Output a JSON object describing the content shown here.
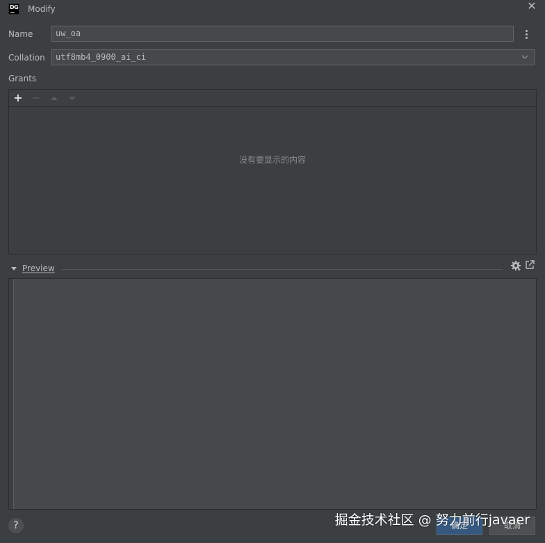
{
  "window": {
    "title": "Modify"
  },
  "form": {
    "name_label": "Name",
    "name_value": "uw_oa",
    "collation_label": "Collation",
    "collation_value": "utf8mb4_0900_ai_ci"
  },
  "grants": {
    "label": "Grants",
    "empty_text": "没有要显示的内容",
    "toolbar": {
      "add": "+",
      "remove": "−"
    }
  },
  "preview": {
    "label": "Preview"
  },
  "footer": {
    "help": "?",
    "ok_label": "确定",
    "cancel_label": "取消"
  },
  "watermark": "掘金技术社区 @ 努力前行javaer",
  "colors": {
    "background": "#3c3f41",
    "accent": "#365880",
    "text": "#bbbbbb"
  },
  "icons": [
    "datagrip-icon",
    "close-icon",
    "kebab-menu-icon",
    "chevron-down-icon",
    "add-icon",
    "remove-icon",
    "move-up-icon",
    "move-down-icon",
    "collapse-arrow-icon",
    "gear-icon",
    "external-link-icon",
    "help-icon"
  ]
}
